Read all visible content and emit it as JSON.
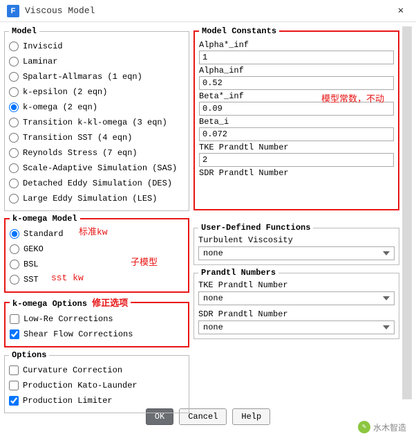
{
  "window": {
    "title": "Viscous Model"
  },
  "model": {
    "legend": "Model",
    "options": [
      "Inviscid",
      "Laminar",
      "Spalart-Allmaras (1 eqn)",
      "k-epsilon (2 eqn)",
      "k-omega (2 eqn)",
      "Transition k-kl-omega (3 eqn)",
      "Transition SST (4 eqn)",
      "Reynolds Stress (7 eqn)",
      "Scale-Adaptive Simulation (SAS)",
      "Detached Eddy Simulation (DES)",
      "Large Eddy Simulation (LES)"
    ],
    "selected_index": 4
  },
  "komega_model": {
    "legend": "k-omega Model",
    "options": [
      "Standard",
      "GEKO",
      "BSL",
      "SST"
    ],
    "selected_index": 0
  },
  "komega_options": {
    "legend": "k-omega Options",
    "items": [
      {
        "label": "Low-Re Corrections",
        "checked": false
      },
      {
        "label": "Shear Flow Corrections",
        "checked": true
      }
    ]
  },
  "options": {
    "legend": "Options",
    "items": [
      {
        "label": "Curvature Correction",
        "checked": false
      },
      {
        "label": "Production Kato-Launder",
        "checked": false
      },
      {
        "label": "Production Limiter",
        "checked": true
      }
    ]
  },
  "model_constants": {
    "legend": "Model Constants",
    "rows": [
      {
        "label": "Alpha*_inf",
        "value": "1"
      },
      {
        "label": "Alpha_inf",
        "value": "0.52"
      },
      {
        "label": "Beta*_inf",
        "value": "0.09"
      },
      {
        "label": "Beta_i",
        "value": "0.072"
      },
      {
        "label": "TKE Prandtl Number",
        "value": "2"
      },
      {
        "label": "SDR Prandtl Number",
        "value": ""
      }
    ]
  },
  "udf": {
    "legend": "User-Defined Functions",
    "label": "Turbulent Viscosity",
    "value": "none"
  },
  "prandtl": {
    "legend": "Prandtl Numbers",
    "rows": [
      {
        "label": "TKE Prandtl Number",
        "value": "none"
      },
      {
        "label": "SDR Prandtl Number",
        "value": "none"
      }
    ]
  },
  "buttons": {
    "ok": "OK",
    "cancel": "Cancel",
    "help": "Help"
  },
  "annotations": {
    "mc": "模型常数，不动",
    "standard_kw": "标准kw",
    "submodel": "子模型",
    "sst_kw": "sst kw",
    "corr": "修正选项"
  },
  "watermark": "水木智造"
}
